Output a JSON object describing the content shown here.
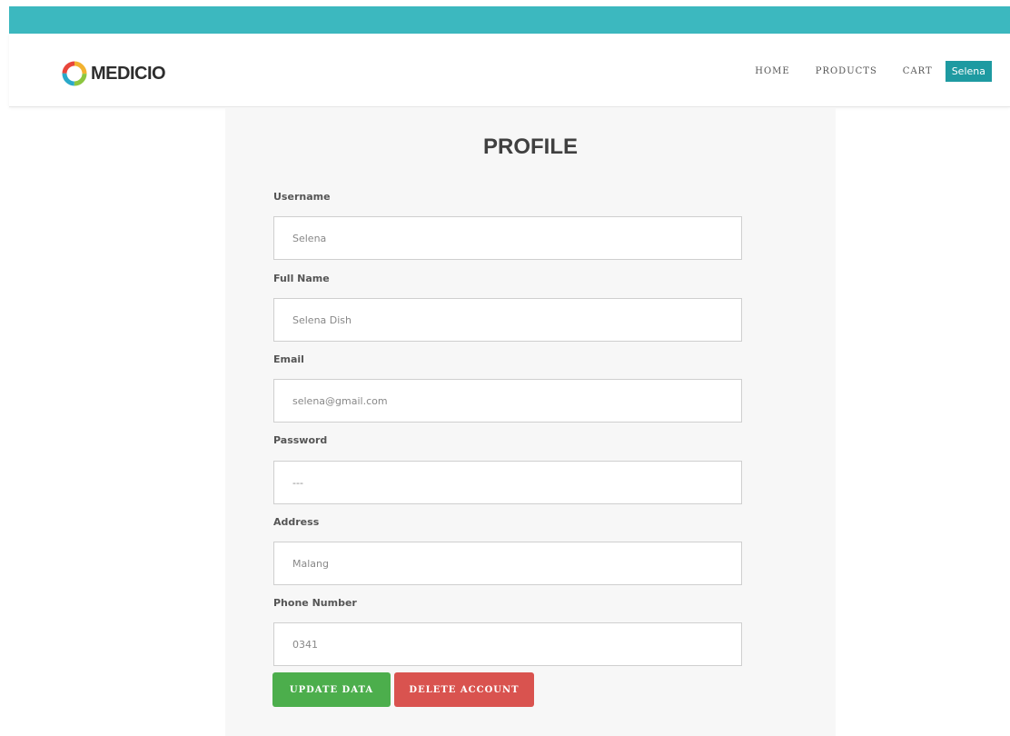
{
  "brand": {
    "logo_text": "MEDICIO",
    "logo_icon": "ring-logo-icon",
    "colors": {
      "topbar": "#3cb8bf",
      "accent": "#1e9aa1",
      "update": "#4cae4c",
      "delete": "#d9534f"
    }
  },
  "nav": {
    "home": "HOME",
    "products": "PRODUCTS",
    "cart": "CART",
    "user": "Selena"
  },
  "profile": {
    "title": "PROFILE",
    "fields": [
      {
        "label": "Username",
        "value": "Selena"
      },
      {
        "label": "Full Name",
        "value": "Selena Dish"
      },
      {
        "label": "Email",
        "value": "selena@gmail.com"
      },
      {
        "label": "Password",
        "value": "---"
      },
      {
        "label": "Address",
        "value": "Malang"
      },
      {
        "label": "Phone Number",
        "value": "0341"
      }
    ],
    "buttons": {
      "update": "UPDATE DATA",
      "delete": "DELETE ACCOUNT"
    }
  }
}
